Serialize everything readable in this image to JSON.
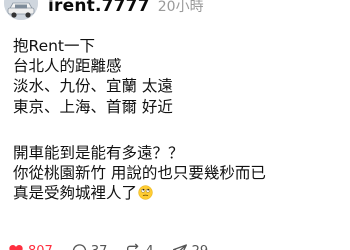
{
  "post": {
    "username": "irent.7777",
    "time": "20小時",
    "lines": [
      "抱Rent一下",
      "台北人的距離感",
      "淡水、九份、宜蘭 太遠",
      "東京、上海、首爾 好近",
      "開車能到是能有多遠？？",
      "你從桃園新竹 用說的也只要幾秒而已",
      "真是受夠城裡人了"
    ],
    "trailing_emoji": "eye-roll-emoji"
  },
  "actions": {
    "likes": "807",
    "comments": "37",
    "reposts": "4",
    "shares": "29"
  },
  "colors": {
    "like": "#ff3040",
    "muted_text": "#9a9a9a",
    "text": "#111111"
  }
}
